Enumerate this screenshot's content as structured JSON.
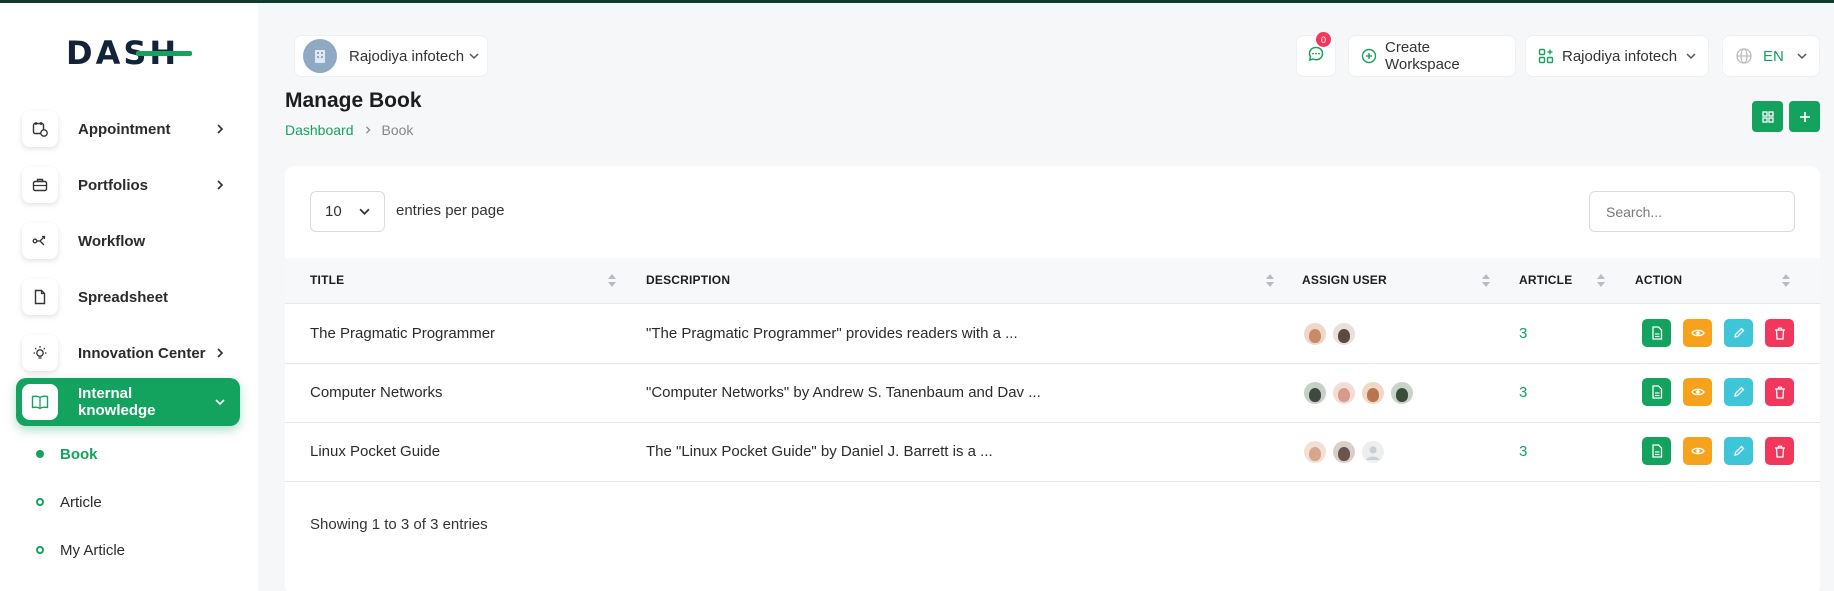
{
  "app": {
    "logo_text": "DASH"
  },
  "sidebar": {
    "items": [
      {
        "label": "Appointment",
        "icon": "calendar-clock-icon",
        "has_chevron": true
      },
      {
        "label": "Portfolios",
        "icon": "briefcase-icon",
        "has_chevron": true
      },
      {
        "label": "Workflow",
        "icon": "workflow-icon",
        "has_chevron": false
      },
      {
        "label": "Spreadsheet",
        "icon": "file-icon",
        "has_chevron": false
      },
      {
        "label": "Innovation Center",
        "icon": "lightbulb-icon",
        "has_chevron": true
      },
      {
        "label": "Internal knowledge",
        "icon": "book-icon",
        "has_chevron": true,
        "active": true
      }
    ],
    "sub_items": [
      {
        "label": "Book",
        "active": true
      },
      {
        "label": "Article",
        "active": false
      },
      {
        "label": "My Article",
        "active": false
      }
    ]
  },
  "header": {
    "workspace_name": "Rajodiya infotech",
    "notification_count": "0",
    "create_workspace_label": "Create Workspace",
    "user_workspace_label": "Rajodiya infotech",
    "language": "EN"
  },
  "page": {
    "title": "Manage Book",
    "breadcrumb": [
      "Dashboard",
      "Book"
    ]
  },
  "table": {
    "entries_value": "10",
    "entries_label": "entries per page",
    "search_placeholder": "Search...",
    "columns": [
      "TITLE",
      "DESCRIPTION",
      "ASSIGN USER",
      "ARTICLE",
      "ACTION"
    ],
    "rows": [
      {
        "title": "The Pragmatic Programmer",
        "description": "\"The Pragmatic Programmer\" provides readers with a ...",
        "users": [
          "#c98a6a",
          "#5b4a40"
        ],
        "article": "3"
      },
      {
        "title": "Computer Networks",
        "description": "\"Computer Networks\" by Andrew S. Tanenbaum and Dav ...",
        "users": [
          "#3f4a3f",
          "#d79a8a",
          "#b8764f",
          "#3a4d3a"
        ],
        "article": "3"
      },
      {
        "title": "Linux Pocket Guide",
        "description": "The \"Linux Pocket Guide\" by Daniel J. Barrett is a ...",
        "users": [
          "#d9a58a",
          "#6b5448",
          "#e5e7ea"
        ],
        "article": "3"
      }
    ],
    "footer": "Showing 1 to 3 of 3 entries"
  },
  "colors": {
    "primary": "#14a35f",
    "warning": "#f6a21c",
    "info": "#3ec5d8",
    "danger": "#f2375d"
  }
}
